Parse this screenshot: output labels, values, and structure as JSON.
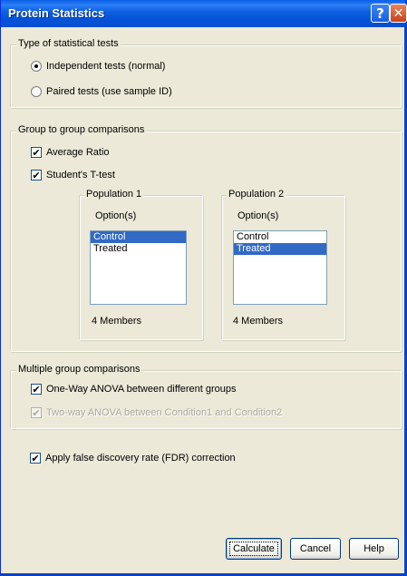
{
  "window": {
    "title": "Protein Statistics",
    "help_glyph": "?",
    "close_glyph": "✕"
  },
  "test_type": {
    "legend": "Type of statistical tests",
    "options": [
      {
        "label": "Independent tests (normal)",
        "selected": true
      },
      {
        "label": "Paired tests (use sample ID)",
        "selected": false
      }
    ]
  },
  "group_to_group": {
    "legend": "Group to group comparisons",
    "average_ratio": {
      "label": "Average Ratio",
      "checked": true
    },
    "t_test": {
      "label": "Student's T-test",
      "checked": true
    },
    "population1": {
      "legend": "Population 1",
      "options_label": "Option(s)",
      "items": [
        "Control",
        "Treated"
      ],
      "selected_index": 0,
      "members": "4 Members"
    },
    "population2": {
      "legend": "Population 2",
      "options_label": "Option(s)",
      "items": [
        "Control",
        "Treated"
      ],
      "selected_index": 1,
      "members": "4 Members"
    }
  },
  "multiple_group": {
    "legend": "Multiple group comparisons",
    "one_way": {
      "label": "One-Way ANOVA between different groups",
      "checked": true
    },
    "two_way": {
      "label": "Two-way ANOVA between Condition1 and Condition2",
      "checked": true,
      "disabled": true
    }
  },
  "fdr": {
    "label": "Apply false discovery rate (FDR) correction",
    "checked": true
  },
  "buttons": {
    "calculate": "Calculate",
    "cancel": "Cancel",
    "help": "Help"
  },
  "icons": {
    "check_glyph": "✔"
  },
  "colors": {
    "titlebar": "#0552d6",
    "dialog_bg": "#ece9d8",
    "selection": "#316ac5"
  }
}
